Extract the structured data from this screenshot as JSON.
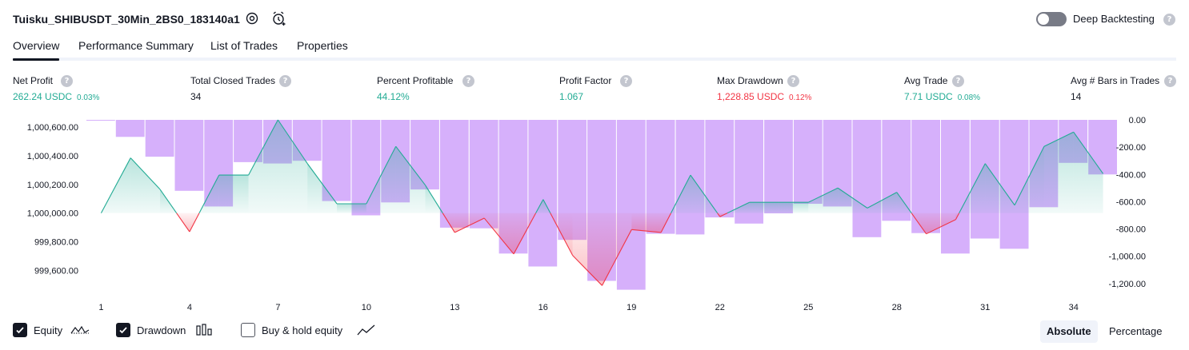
{
  "header": {
    "strategy_name": "Tuisku_SHIBUSDT_30Min_2BS0_183140a1",
    "deep_backtesting_label": "Deep Backtesting",
    "deep_backtesting_enabled": false,
    "help_glyph": "?"
  },
  "tabs": [
    {
      "label": "Overview",
      "active": true
    },
    {
      "label": "Performance Summary",
      "active": false
    },
    {
      "label": "List of Trades",
      "active": false
    },
    {
      "label": "Properties",
      "active": false
    }
  ],
  "metrics": [
    {
      "label": "Net Profit",
      "value": "262.24 USDC",
      "pct": "0.03%",
      "color": "#22ab94"
    },
    {
      "label": "Total Closed Trades",
      "value": "34",
      "pct": "",
      "color": "#131722"
    },
    {
      "label": "Percent Profitable",
      "value": "44.12%",
      "pct": "",
      "color": "#22ab94"
    },
    {
      "label": "Profit Factor",
      "value": "1.067",
      "pct": "",
      "color": "#22ab94"
    },
    {
      "label": "Max Drawdown",
      "value": "1,228.85 USDC",
      "pct": "0.12%",
      "color": "#f23645"
    },
    {
      "label": "Avg Trade",
      "value": "7.71 USDC",
      "pct": "0.08%",
      "color": "#22ab94"
    },
    {
      "label": "Avg # Bars in Trades",
      "value": "14",
      "pct": "",
      "color": "#131722"
    }
  ],
  "chart_data": {
    "type": "line",
    "x_tick_labels": [
      "1",
      "4",
      "7",
      "10",
      "13",
      "16",
      "19",
      "22",
      "25",
      "28",
      "31",
      "34"
    ],
    "left_axis": {
      "ticks": [
        "1,000,600.00",
        "1,000,400.00",
        "1,000,200.00",
        "1,000,000.00",
        "999,800.00",
        "999,600.00"
      ],
      "ylim": [
        999480,
        1000650
      ],
      "baseline": 1000000
    },
    "right_axis": {
      "ticks": [
        "0.00",
        "-200.00",
        "-400.00",
        "-600.00",
        "-800.00",
        "-1,000.00",
        "-1,200.00"
      ],
      "ylim": [
        -1230,
        0
      ]
    },
    "x": [
      1,
      2,
      3,
      4,
      5,
      6,
      7,
      8,
      9,
      10,
      11,
      12,
      13,
      14,
      15,
      16,
      17,
      18,
      19,
      20,
      21,
      22,
      23,
      24,
      25,
      26,
      27,
      28,
      29,
      30,
      31,
      34.0,
      32,
      33,
      34,
      35
    ],
    "series": [
      {
        "name": "Equity",
        "x": [
          1,
          2,
          3,
          4,
          5,
          6,
          7,
          8,
          9,
          10,
          11,
          12,
          13,
          14,
          15,
          16,
          17,
          18,
          19,
          20,
          21,
          22,
          23,
          24,
          25,
          26,
          27,
          28,
          29,
          30,
          31,
          32,
          33,
          34,
          35
        ],
        "values": [
          1000000,
          1000385,
          1000165,
          999870,
          1000265,
          1000265,
          1000650,
          1000345,
          1000065,
          1000065,
          1000465,
          1000195,
          999865,
          999965,
          999715,
          1000095,
          999705,
          999495,
          999885,
          999865,
          1000265,
          999975,
          1000075,
          1000075,
          1000075,
          1000175,
          1000035,
          1000145,
          999855,
          999955,
          1000345,
          1000055,
          1000465,
          1000565,
          1000275
        ],
        "color_up": "#22ab94",
        "color_down": "#f23645"
      },
      {
        "name": "Drawdown",
        "x": [
          1,
          2,
          3,
          4,
          5,
          6,
          7,
          8,
          9,
          10,
          11,
          12,
          13,
          14,
          15,
          16,
          17,
          18,
          19,
          20,
          21,
          22,
          23,
          24,
          25,
          26,
          27,
          28,
          29,
          30,
          31,
          32,
          33,
          34,
          35
        ],
        "values": [
          -5,
          -125,
          -270,
          -520,
          -635,
          -310,
          -320,
          -300,
          -595,
          -700,
          -605,
          -510,
          -790,
          -795,
          -980,
          -1075,
          -880,
          -1180,
          -1245,
          -835,
          -840,
          -715,
          -760,
          -685,
          -615,
          -635,
          -860,
          -740,
          -830,
          -980,
          -870,
          -945,
          -640,
          -315,
          -400
        ],
        "color": "#d6b0fb"
      },
      {
        "name": "Buy & hold equity",
        "values": []
      }
    ]
  },
  "legend": [
    {
      "label": "Equity",
      "checked": true,
      "icon": "equity-line-icon"
    },
    {
      "label": "Drawdown",
      "checked": true,
      "icon": "drawdown-bars-icon"
    },
    {
      "label": "Buy & hold equity",
      "checked": false,
      "icon": "buy-hold-line-icon"
    }
  ],
  "view_modes": [
    {
      "label": "Absolute",
      "active": true
    },
    {
      "label": "Percentage",
      "active": false
    }
  ]
}
